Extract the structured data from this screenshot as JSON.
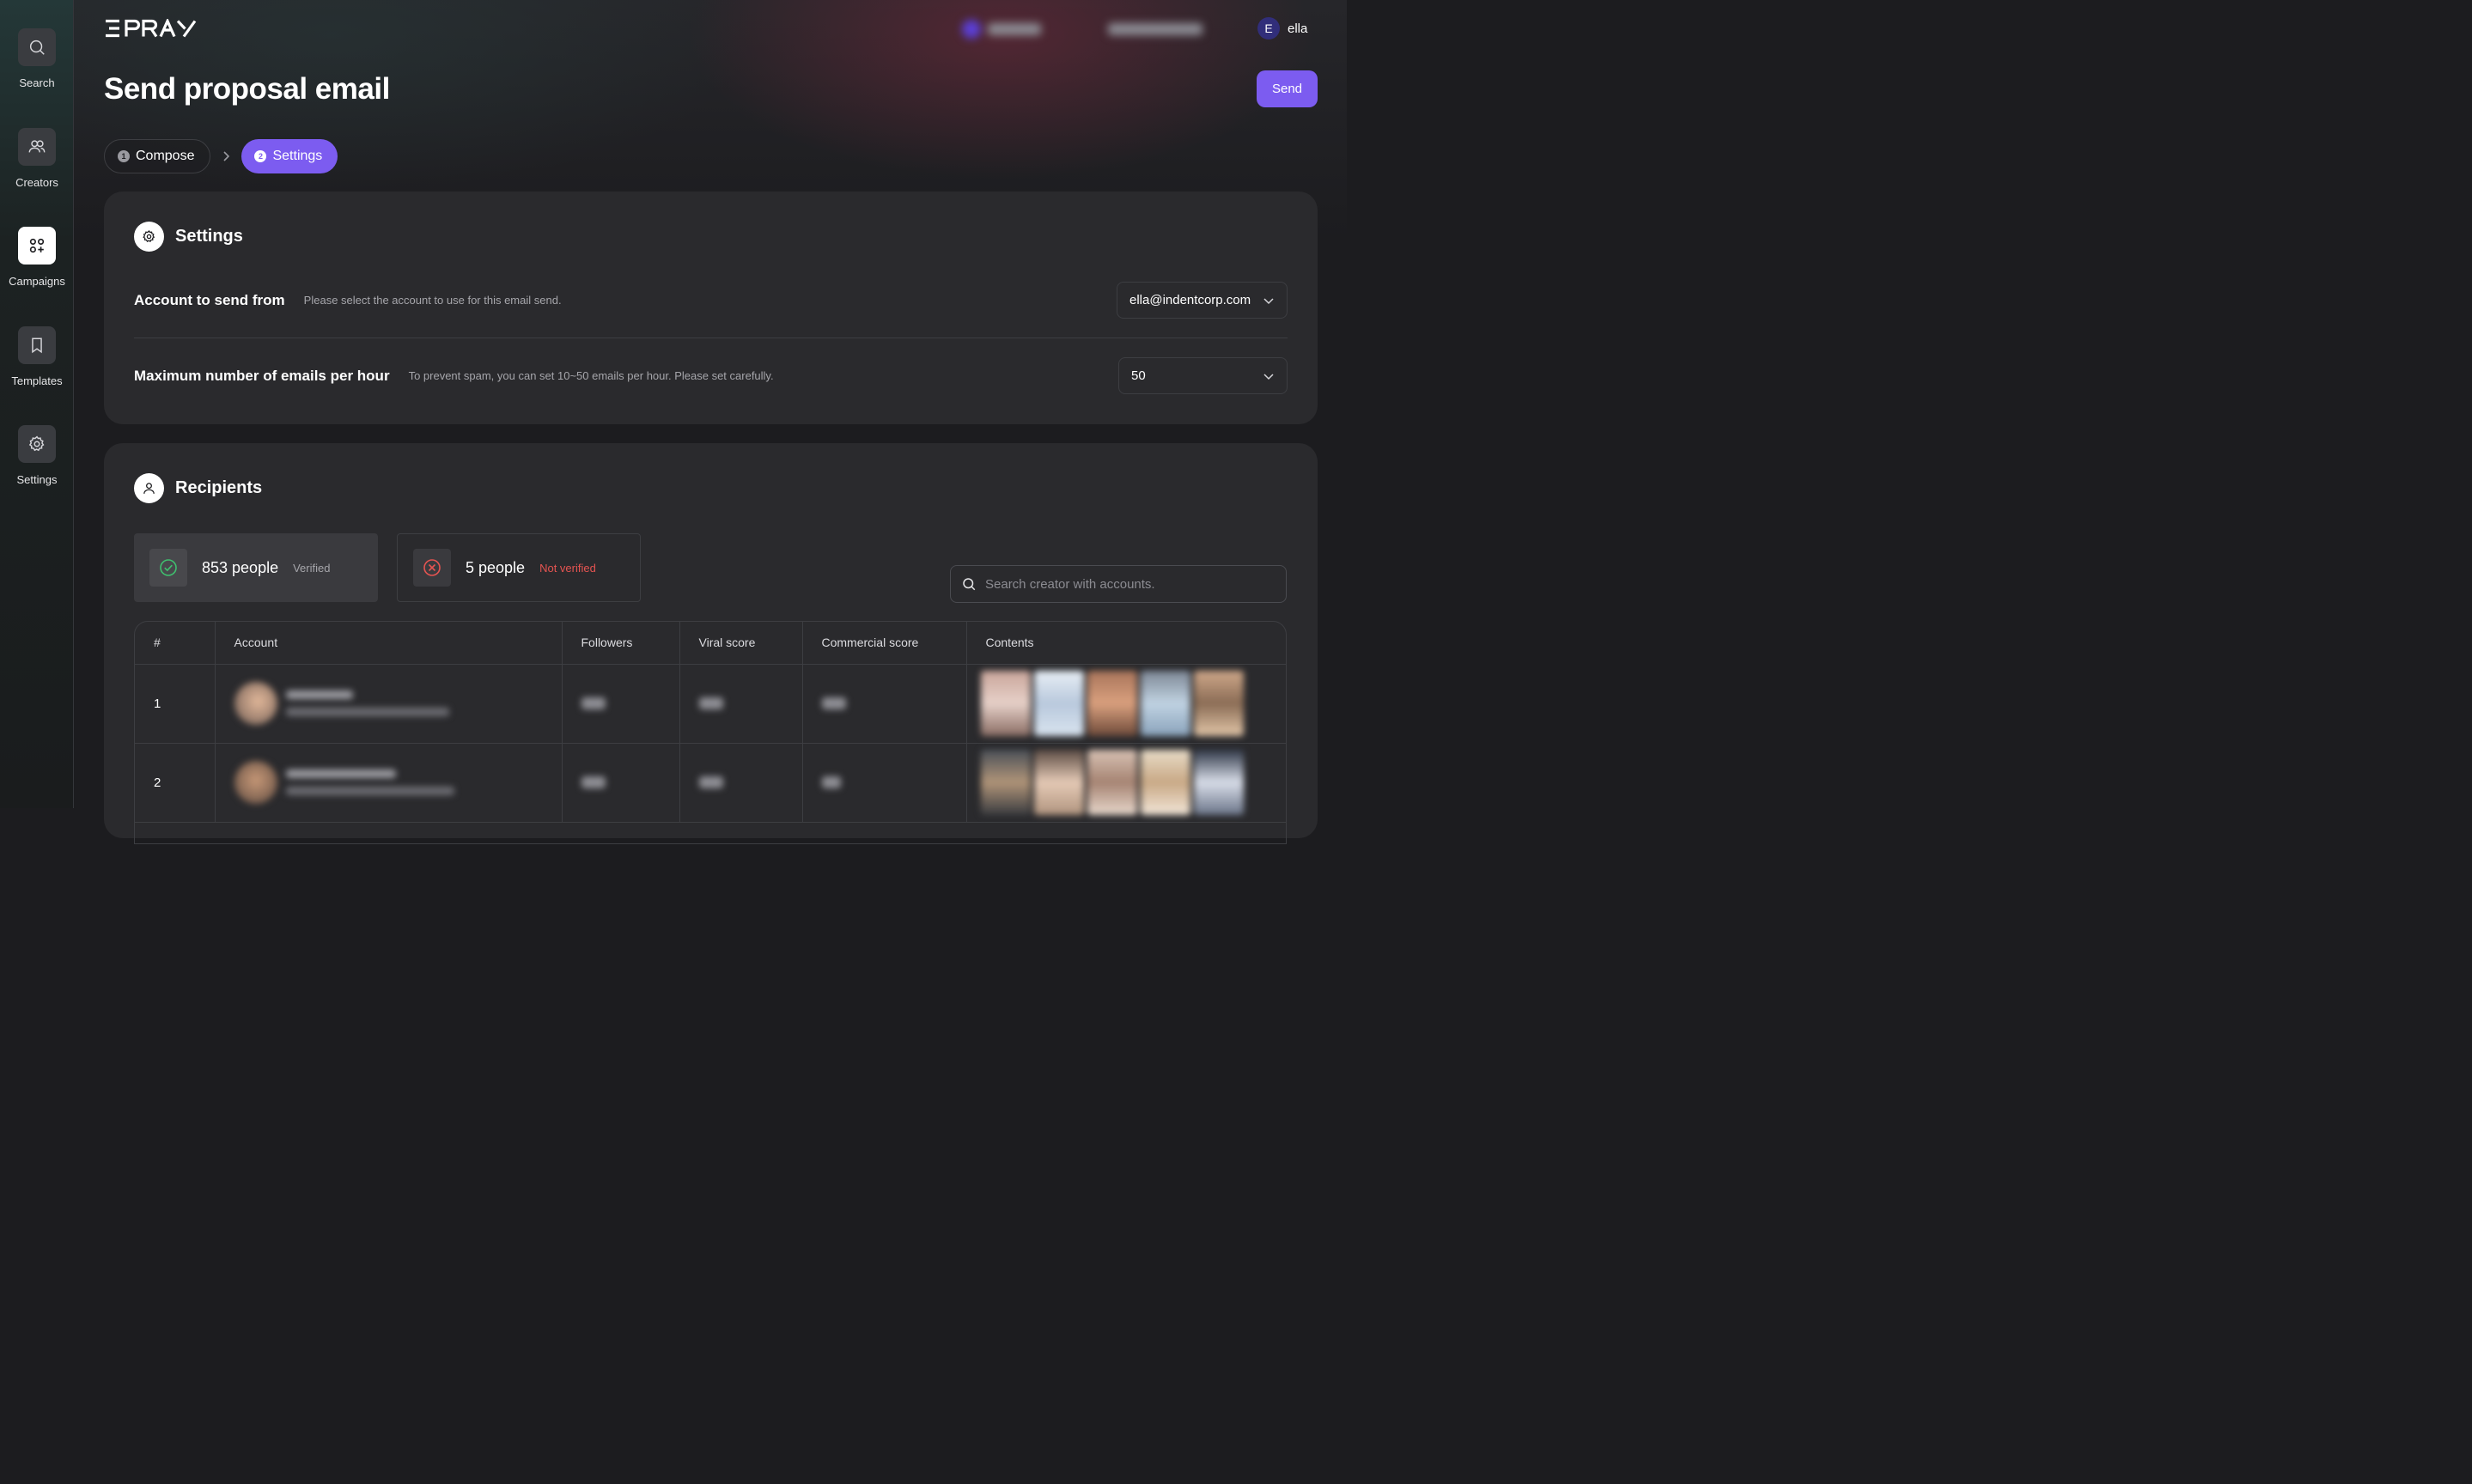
{
  "app": {
    "logo_text": "EPRAY"
  },
  "sidebar": {
    "items": [
      {
        "label": "Search",
        "icon": "search-icon",
        "active": false
      },
      {
        "label": "Creators",
        "icon": "users-icon",
        "active": false
      },
      {
        "label": "Campaigns",
        "icon": "grid-plus-icon",
        "active": true
      },
      {
        "label": "Templates",
        "icon": "bookmark-icon",
        "active": false
      },
      {
        "label": "Settings",
        "icon": "gear-icon",
        "active": false
      }
    ]
  },
  "user": {
    "initial": "E",
    "name": "ella"
  },
  "header": {
    "title": "Send proposal email",
    "send_label": "Send"
  },
  "steps": [
    {
      "num": "1",
      "label": "Compose",
      "active": false
    },
    {
      "num": "2",
      "label": "Settings",
      "active": true
    }
  ],
  "settings": {
    "title": "Settings",
    "account": {
      "label": "Account to send from",
      "description": "Please select the account to use for this email send.",
      "value": "ella@indentcorp.com"
    },
    "max_emails": {
      "label": "Maximum number of emails per hour",
      "description": "To prevent spam, you can set 10~50 emails per hour. Please set carefully.",
      "value": "50"
    }
  },
  "recipients": {
    "title": "Recipients",
    "verified": {
      "count": "853 people",
      "status": "Verified"
    },
    "unverified": {
      "count": "5 people",
      "status": "Not verified"
    },
    "search_placeholder": "Search creator with accounts.",
    "columns": [
      "#",
      "Account",
      "Followers",
      "Viral score",
      "Commercial score",
      "Contents"
    ],
    "rows": [
      {
        "index": "1"
      },
      {
        "index": "2"
      }
    ]
  },
  "colors": {
    "accent": "#7c5cf0",
    "verified": "#3fbf6e",
    "not_verified": "#e55451",
    "card_bg": "#2a2a2d"
  }
}
